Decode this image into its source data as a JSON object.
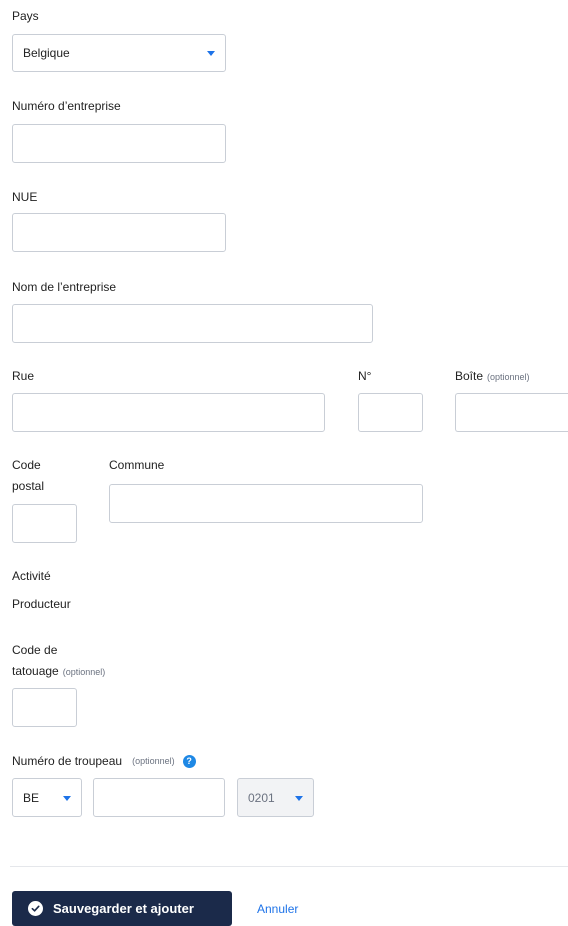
{
  "country": {
    "label": "Pays",
    "value": "Belgique"
  },
  "company_number": {
    "label": "Numéro d’entreprise",
    "value": ""
  },
  "nue": {
    "label": "NUE",
    "value": ""
  },
  "company_name": {
    "label": "Nom de l’entreprise",
    "value": ""
  },
  "street": {
    "label": "Rue",
    "value": ""
  },
  "number": {
    "label": "N°",
    "value": ""
  },
  "box": {
    "label": "Boîte",
    "optional": "(optionnel)",
    "value": ""
  },
  "postal_code": {
    "label_line1": "Code",
    "label_line2": "postal",
    "value": ""
  },
  "commune": {
    "label": "Commune",
    "value": ""
  },
  "activity": {
    "label": "Activité",
    "value": "Producteur"
  },
  "tattoo_code": {
    "label_line1": "Code de",
    "label_line2": "tatouage",
    "optional": "(optionnel)",
    "value": ""
  },
  "herd_number": {
    "label": "Numéro de troupeau",
    "optional": "(optionnel)",
    "help": "?",
    "country_prefix": "BE",
    "value": "",
    "suffix": "0201"
  },
  "actions": {
    "save_label": "Sauvegarder et ajouter",
    "cancel_label": "Annuler"
  }
}
